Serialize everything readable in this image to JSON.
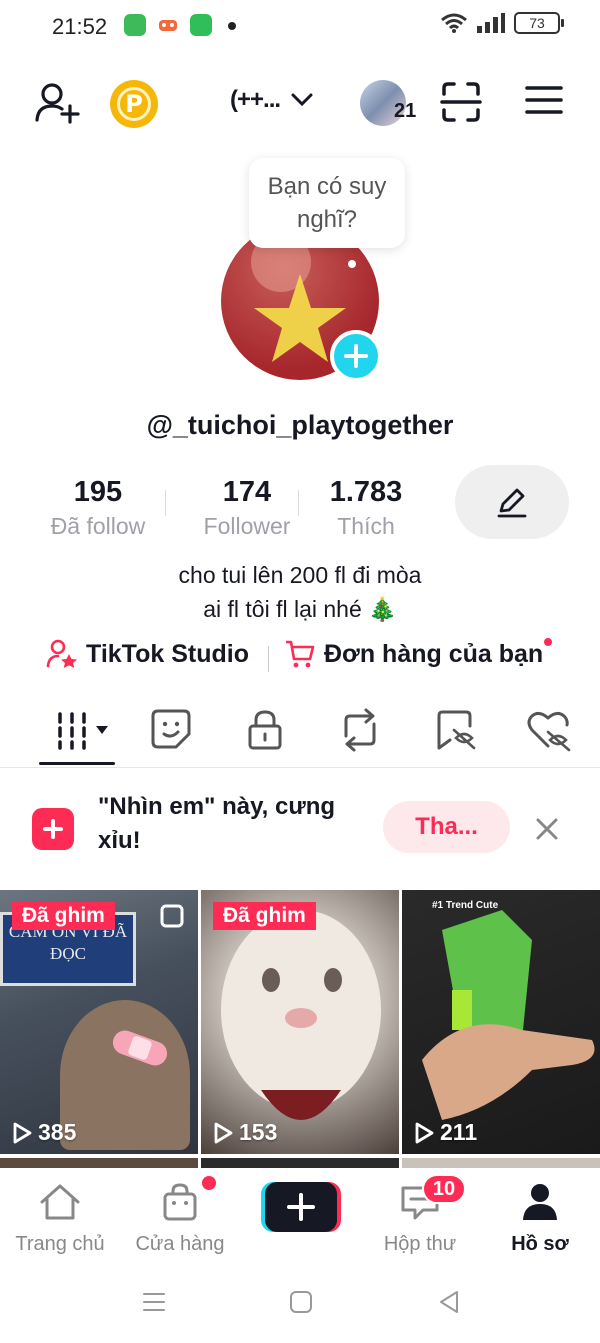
{
  "status_bar": {
    "time": "21:52",
    "battery": "73"
  },
  "top_bar": {
    "add_friend_icon": "person-plus-icon",
    "coin_label": "P",
    "account_switch_label": "(++...",
    "avatar_count": "21",
    "scan_icon": "scan-icon",
    "menu_icon": "hamburger-icon"
  },
  "profile": {
    "thought_bubble": "Bạn có suy nghĩ?",
    "username": "@_tuichoi_playtogether",
    "stats": [
      {
        "value": "195",
        "label": "Đã follow"
      },
      {
        "value": "174",
        "label": "Follower"
      },
      {
        "value": "1.783",
        "label": "Thích"
      }
    ],
    "bio_line1": "cho tui lên 200 fl đi mòa",
    "bio_line2": "ai fl tôi fl lại nhé 🎄",
    "studio_link": "TikTok Studio",
    "orders_link": "Đơn hàng của bạn"
  },
  "banner": {
    "text": "\"Nhìn em\" này, cưng xỉu!",
    "button": "Tha..."
  },
  "videos": [
    {
      "pinned": "Đã ghim",
      "views": "385",
      "overlay": "CẢM ƠN VÌ ĐÃ ĐỌC"
    },
    {
      "pinned": "Đã ghim",
      "views": "153"
    },
    {
      "views": "211",
      "overlay": "#1 Trend Cute"
    }
  ],
  "bottom_nav": {
    "home": "Trang chủ",
    "shop": "Cửa hàng",
    "inbox": "Hộp thư",
    "inbox_badge": "10",
    "profile": "Hồ sơ"
  },
  "colors": {
    "accent": "#fe2c55",
    "cyan": "#20d5ec",
    "text": "#161823"
  }
}
